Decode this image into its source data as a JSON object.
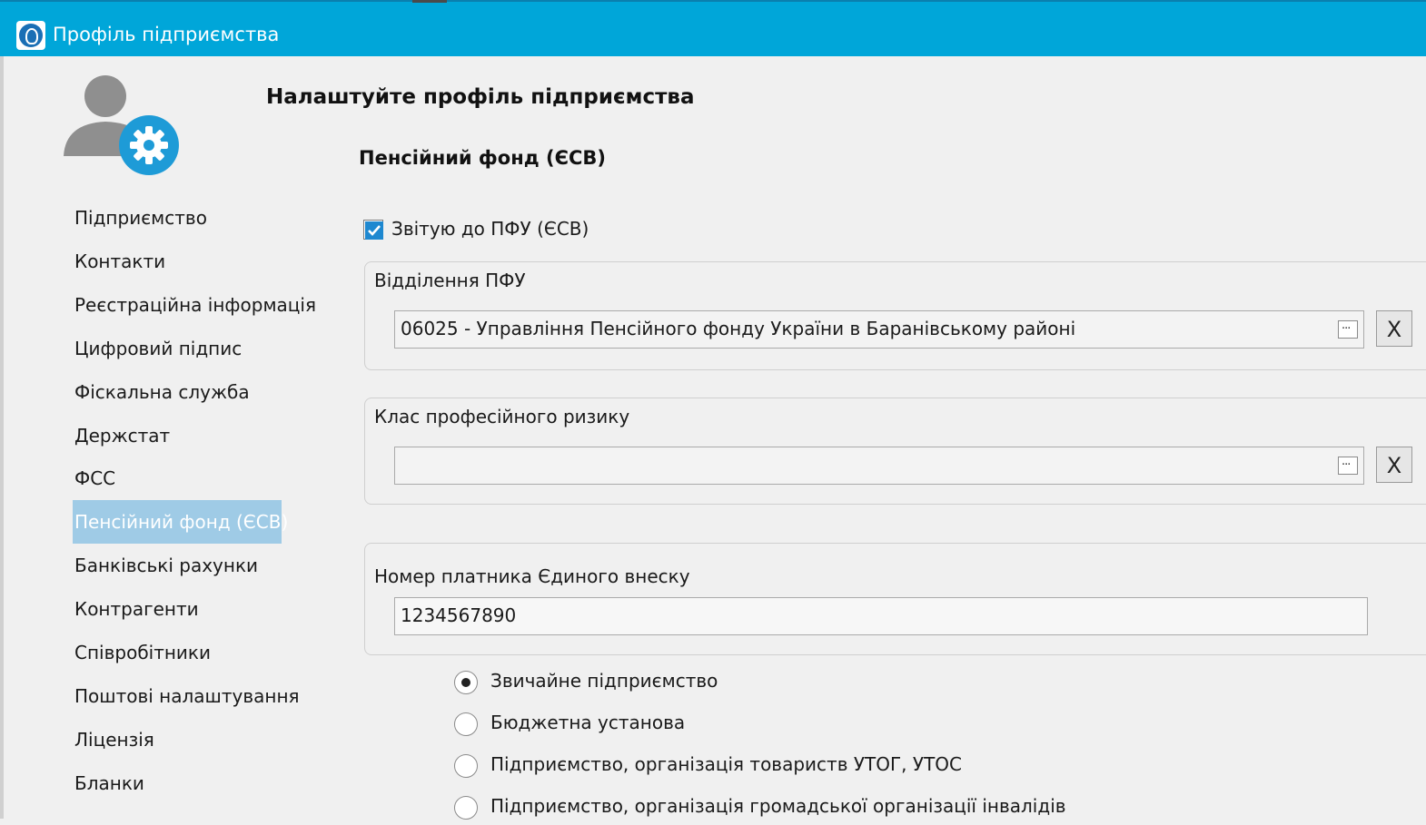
{
  "window": {
    "title": "Профіль підприємства"
  },
  "page": {
    "heading": "Налаштуйте профіль підприємства",
    "section_title": "Пенсійний фонд (ЄСВ)"
  },
  "nav": {
    "items": [
      {
        "label": "Підприємство",
        "active": false
      },
      {
        "label": "Контакти",
        "active": false
      },
      {
        "label": "Реєстраційна інформація",
        "active": false
      },
      {
        "label": "Цифровий підпис",
        "active": false
      },
      {
        "label": "Фіскальна служба",
        "active": false
      },
      {
        "label": "Держстат",
        "active": false
      },
      {
        "label": "ФСС",
        "active": false
      },
      {
        "label": "Пенсійний фонд (ЄСВ)",
        "active": true
      },
      {
        "label": "Банківські рахунки",
        "active": false
      },
      {
        "label": "Контрагенти",
        "active": false
      },
      {
        "label": "Співробітники",
        "active": false
      },
      {
        "label": "Поштові налаштування",
        "active": false
      },
      {
        "label": "Ліцензія",
        "active": false
      },
      {
        "label": "Бланки",
        "active": false
      }
    ]
  },
  "form": {
    "report_checkbox": {
      "label": "Звітую до ПФУ (ЄСВ)",
      "checked": true
    },
    "pfu_department": {
      "label": "Відділення ПФУ",
      "value": "06025 - Управління Пенсійного фонду України в Баранівському районі",
      "clear_label": "X"
    },
    "risk_class": {
      "label": "Клас професійного ризику",
      "value": "",
      "clear_label": "X"
    },
    "payer_number": {
      "label": "Номер платника Єдиного внеску",
      "value": "1234567890"
    },
    "enterprise_type": {
      "options": [
        {
          "label": "Звичайне підприємство",
          "selected": true
        },
        {
          "label": "Бюджетна установа",
          "selected": false
        },
        {
          "label": "Підприємство, організація товариств УТОГ, УТОС",
          "selected": false
        },
        {
          "label": "Підприємство, організація громадської організації інвалідів",
          "selected": false
        }
      ]
    }
  },
  "colors": {
    "titlebar": "#00a6d9",
    "nav_active_bg": "#9fcbe6",
    "avatar_badge": "#1e9bd7",
    "avatar_person": "#8f8f8f"
  }
}
